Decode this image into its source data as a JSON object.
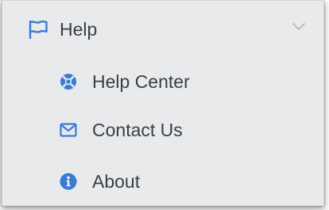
{
  "menu": {
    "header": {
      "label": "Help",
      "icon": "flag-icon",
      "expanded": true
    },
    "items": [
      {
        "label": "Help Center",
        "icon": "lifebuoy-icon"
      },
      {
        "label": "Contact Us",
        "icon": "envelope-icon"
      },
      {
        "label": "About",
        "icon": "info-circle-icon"
      }
    ]
  },
  "colors": {
    "accent": "#3a7bd5",
    "text": "#3a3f44",
    "background": "#e9eaeb",
    "chevron": "#b5b8bb"
  }
}
